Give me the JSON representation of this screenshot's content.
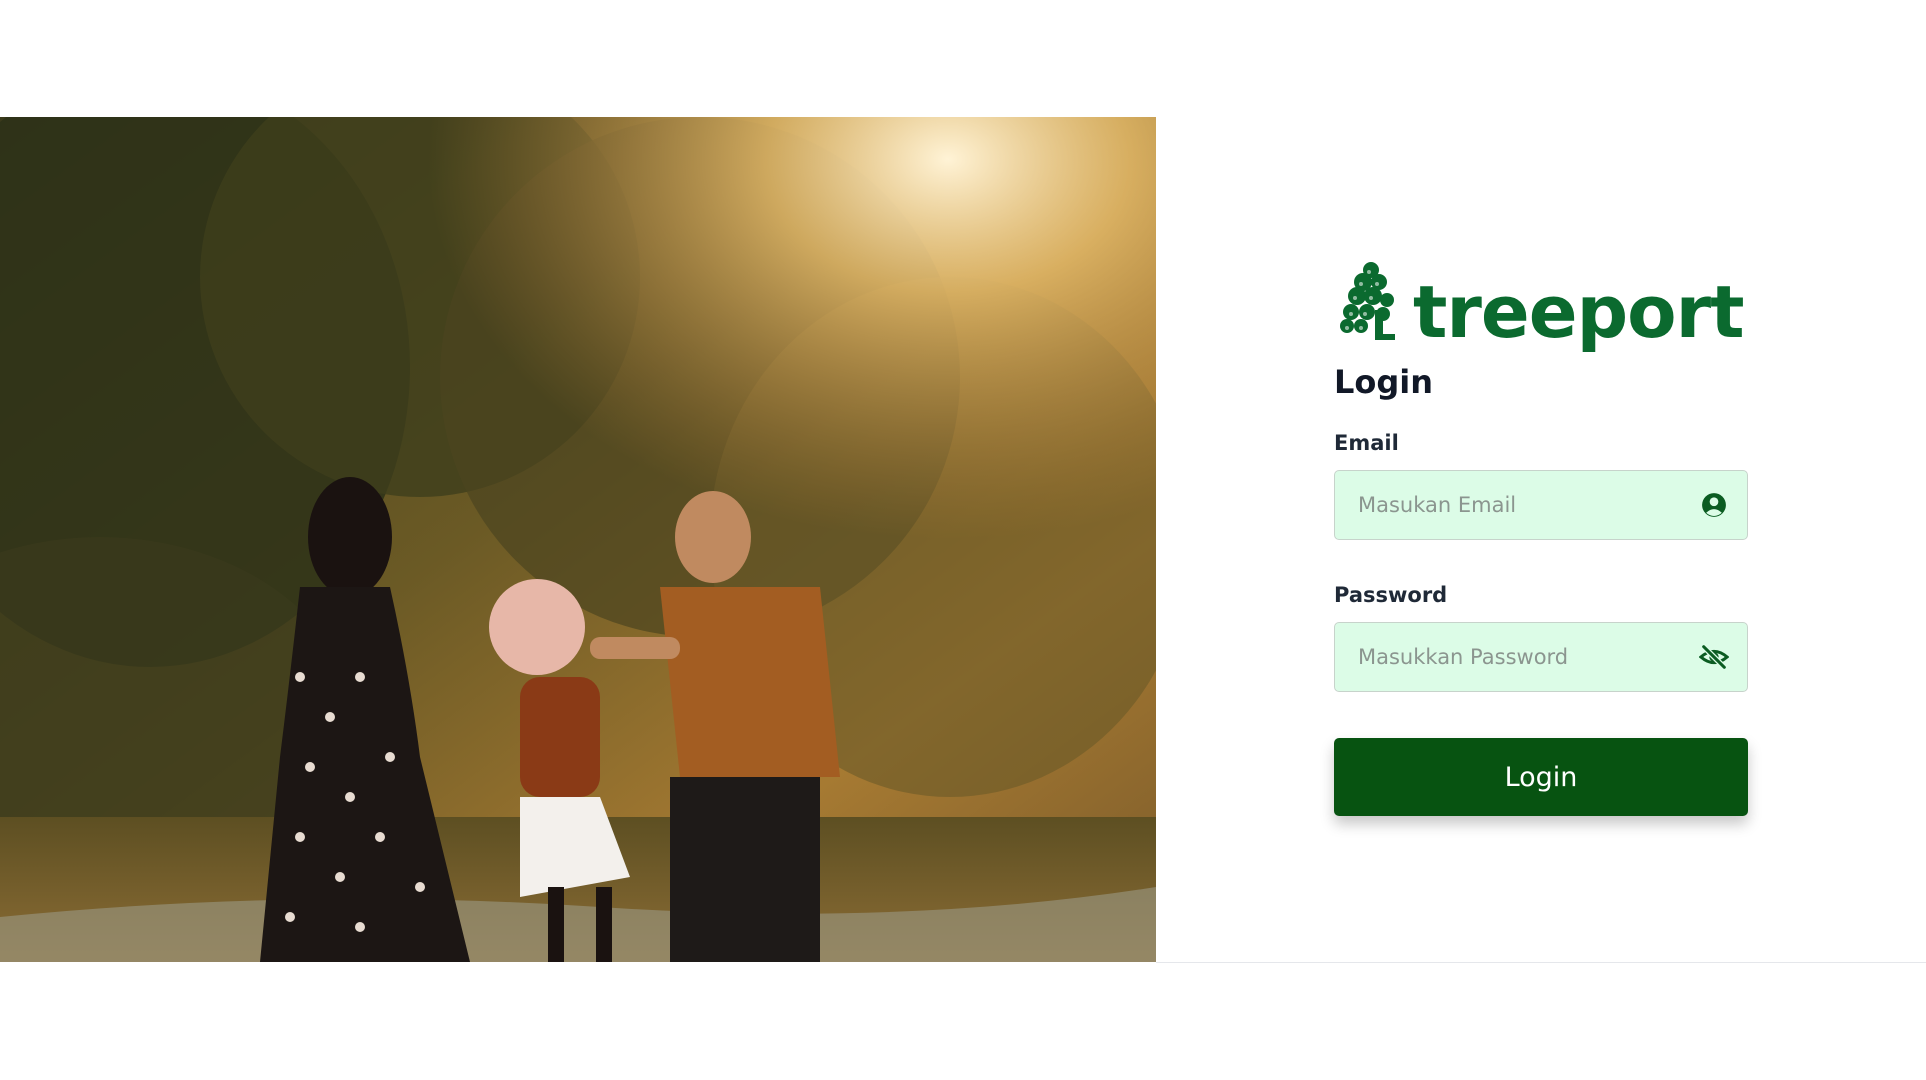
{
  "brand": {
    "name": "treeport",
    "logo_icon": "tree-icon",
    "color": "#0b6a2f"
  },
  "hero": {
    "description": "family-walking-photo"
  },
  "login": {
    "title": "Login",
    "email": {
      "label": "Email",
      "placeholder": "Masukan Email",
      "value": "",
      "icon": "user-circle-icon"
    },
    "password": {
      "label": "Password",
      "placeholder": "Masukkan Password",
      "value": "",
      "icon": "eye-slash-icon"
    },
    "button_label": "Login",
    "button_color": "#075311",
    "input_bg": "#dcfce7"
  }
}
